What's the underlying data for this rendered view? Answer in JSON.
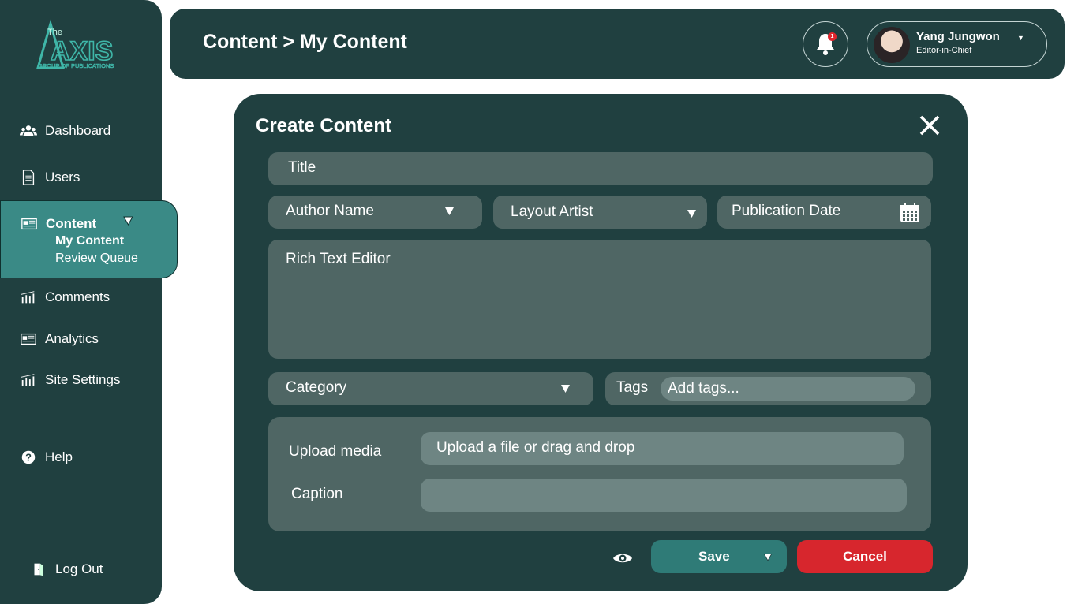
{
  "brand": {
    "logo_top_text": "The",
    "logo_main_text": "AXIS",
    "logo_sub_text": "GROUP OF PUBLICATIONS",
    "accent": "#3a8a86",
    "dark": "#204040",
    "danger": "#d7262d"
  },
  "sidebar": {
    "items": [
      {
        "label": "Dashboard",
        "icon": "users-icon"
      },
      {
        "label": "Users",
        "icon": "document-icon"
      },
      {
        "label": "Comments",
        "icon": "bar-chart-icon"
      },
      {
        "label": "Analytics",
        "icon": "newspaper-icon"
      },
      {
        "label": "Site Settings",
        "icon": "bar-chart-icon"
      }
    ],
    "content_group": {
      "label": "Content",
      "icon": "newspaper-icon",
      "subitems": [
        "My Content",
        "Review Queue"
      ]
    },
    "help": {
      "label": "Help",
      "icon": "help-icon"
    },
    "logout": {
      "label": "Log Out",
      "icon": "logout-icon"
    }
  },
  "header": {
    "breadcrumb": "Content >  My Content",
    "notifications_count": "1",
    "user": {
      "name": "Yang Jungwon",
      "role": "Editor-in-Chief"
    }
  },
  "modal": {
    "title": "Create Content",
    "title_field": "Title",
    "author_field": "Author Name",
    "layout_field": "Layout Artist",
    "date_field": "Publication Date",
    "editor_field": "Rich Text Editor",
    "category_field": "Category",
    "tags_label": "Tags",
    "tags_placeholder": "Add tags...",
    "upload_label": "Upload media",
    "upload_placeholder": "Upload a file or drag and drop",
    "caption_label": "Caption",
    "caption_value": "",
    "save_label": "Save",
    "cancel_label": "Cancel"
  }
}
